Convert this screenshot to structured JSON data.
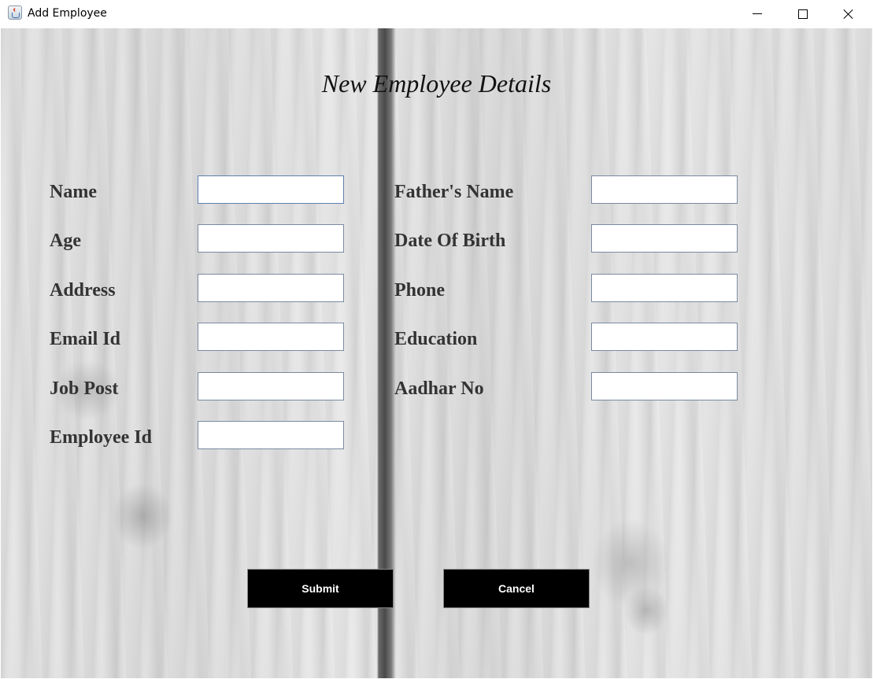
{
  "window": {
    "title": "Add Employee",
    "icon": "java-cup-icon",
    "controls": {
      "minimize": "minimize-icon",
      "maximize": "maximize-icon",
      "close": "close-icon"
    }
  },
  "form": {
    "heading": "New Employee Details",
    "left_fields": [
      {
        "label": "Name",
        "value": ""
      },
      {
        "label": "Age",
        "value": ""
      },
      {
        "label": "Address",
        "value": ""
      },
      {
        "label": "Email Id",
        "value": ""
      },
      {
        "label": "Job Post",
        "value": ""
      },
      {
        "label": "Employee Id",
        "value": ""
      }
    ],
    "right_fields": [
      {
        "label": "Father's Name",
        "value": ""
      },
      {
        "label": "Date Of Birth",
        "value": ""
      },
      {
        "label": "Phone",
        "value": ""
      },
      {
        "label": "Education",
        "value": ""
      },
      {
        "label": "Aadhar No",
        "value": ""
      }
    ],
    "buttons": {
      "submit": "Submit",
      "cancel": "Cancel"
    }
  },
  "colors": {
    "button_bg": "#000000",
    "button_text": "#ffffff",
    "label_text": "#333333"
  }
}
